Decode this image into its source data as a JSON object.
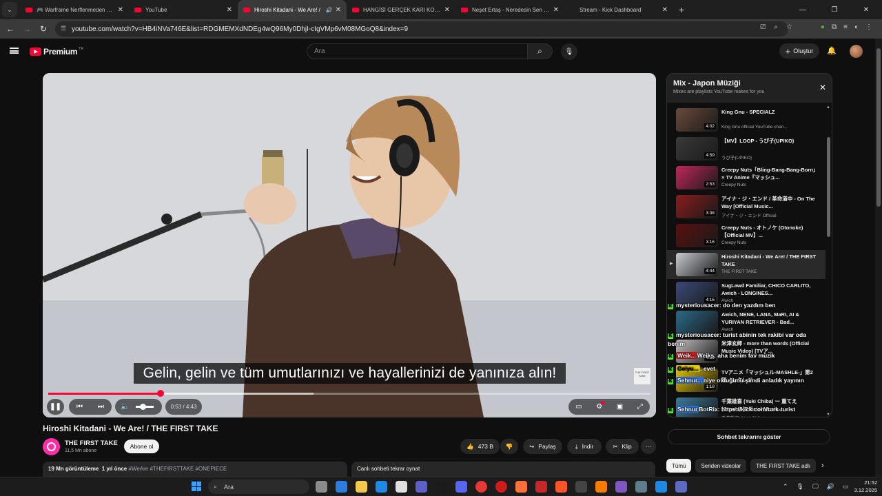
{
  "browser": {
    "tabs": [
      {
        "title": "🎮 Warframe Nerflenmeden Ö…",
        "favicon": "youtube-icon",
        "active": false,
        "audio": false
      },
      {
        "title": "YouTube",
        "favicon": "youtube-icon",
        "active": false,
        "audio": false
      },
      {
        "title": "Hiroshi Kitadani - We Are! /",
        "favicon": "youtube-icon",
        "active": true,
        "audio": true
      },
      {
        "title": "HANGİSİ GERÇEK KARI KOCA?!",
        "favicon": "youtube-icon",
        "active": false,
        "audio": false
      },
      {
        "title": "Neşet Ertaş - Neredesin Sen (Ja…",
        "favicon": "youtube-icon",
        "active": false,
        "audio": false
      },
      {
        "title": "Stream - Kick Dashboard",
        "favicon": "kick-icon",
        "active": false,
        "audio": false
      }
    ],
    "url": "youtube.com/watch?v=HB4iNVa746E&list=RDGMEMXdNDEg4wQ96My0DhjI-cIgVMp6vM08MGoQ8&index=9",
    "icons": [
      "back-icon",
      "forward-icon",
      "reload-icon",
      "site-info-icon",
      "cast-icon",
      "zoom-icon",
      "bookmark-star-icon",
      "extension-icon",
      "puzzle-icon",
      "reading-list-icon",
      "profile-icon",
      "menu-icon"
    ]
  },
  "youtube": {
    "logo_text": "Premium",
    "logo_mark": "TR",
    "search_placeholder": "Ara",
    "create_label": "Oluştur"
  },
  "player": {
    "subtitle": "Gelin, gelin ve tüm umutlarınızı ve hayallerinizi de yanınıza alın!",
    "watermark": "THE FIRST TAKE",
    "current_time": "0:53",
    "duration": "4:43",
    "progress": 0.187,
    "buffered": 0.44,
    "volume": 0.3,
    "state": "playing"
  },
  "video": {
    "title": "Hiroshi Kitadani - We Are! / THE FIRST TAKE",
    "channel": "THE FIRST TAKE",
    "subscribers": "11,5 Mn abone",
    "subscribe_label": "Abone ol",
    "likes": "473 B",
    "share_label": "Paylaş",
    "download_label": "İndir",
    "clip_label": "Klip",
    "views": "19 Mn görüntüleme",
    "age": "1 yıl önce",
    "tags": "#WeAre #THEFIRSTTAKE #ONEPIECE",
    "live_chat_replay": "Canlı sohbeti tekrar oynat"
  },
  "playlist": {
    "title": "Mix - Japon Müziği",
    "subtitle": "Mixes are playlists YouTube makes for you",
    "items": [
      {
        "title": "King Gnu - SPECIALZ",
        "channel": "King Gnu official YouTube chan...",
        "duration": "4:02",
        "current": false,
        "thumb_color": "#6b4a3a"
      },
      {
        "title": "【MV】LOOP - うぴ子(UPIKO)",
        "channel": "うぴ子(UPIKO)",
        "duration": "4:59",
        "current": false,
        "thumb_color": "#3a3a3a"
      },
      {
        "title": "Creepy Nuts「Bling-Bang-Bang-Born」× TV Anime『マッシュ...",
        "channel": "Creepy Nuts",
        "duration": "2:53",
        "current": false,
        "thumb_color": "#c0275a"
      },
      {
        "title": "アイナ・ジ・エンド / 革命道中 - On The Way [Official Music...",
        "channel": "アイナ・ジ・エンド Official",
        "duration": "3:38",
        "current": false,
        "thumb_color": "#8a1c1c"
      },
      {
        "title": "Creepy Nuts - オトノケ (Otonoke) 【Official MV】...",
        "channel": "Creepy Nuts",
        "duration": "3:16",
        "current": false,
        "thumb_color": "#5a1010"
      },
      {
        "title": "Hiroshi Kitadani - We Are! / THE FIRST TAKE",
        "channel": "THE FIRST TAKE",
        "duration": "4:44",
        "current": true,
        "thumb_color": "#c9ccd2"
      },
      {
        "title": "SugLawd Familiar, CHICO CARLITO, Awich - LONGINES...",
        "channel": "Awich",
        "duration": "4:16",
        "current": false,
        "thumb_color": "#3b4a7a"
      },
      {
        "title": "Awich, NENE, LANA, MaRI, AI & YURIYAN RETRIEVER - Bad...",
        "channel": "Awich",
        "duration": "",
        "current": false,
        "thumb_color": "#2a6a8a"
      },
      {
        "title": "米津玄師 - more than words (Official Music Video) [TVア...",
        "channel": "",
        "duration": "4:59",
        "current": false,
        "thumb_color": "#bfbfbf"
      },
      {
        "title": "TVアニメ「マッシュル-MASHLE-」第2期ノンクレジ...",
        "channel": "",
        "duration": "1:18",
        "current": false,
        "thumb_color": "#e0c000"
      },
      {
        "title": "千葉雄喜 (Yuki Chiba) ー 重てえ (Omote) [Official Music...",
        "channel": "千葉雄喜 (Yuki Chiba)",
        "duration": "",
        "current": false,
        "thumb_color": "#3a7a9a"
      }
    ],
    "show_chat_replay": "Sohbet tekrarını göster"
  },
  "kick_chat": [
    {
      "user": "mysteriousacer",
      "message": ": do den yazdım ben",
      "tag": ""
    },
    {
      "user": "mysteriousacer",
      "message": ": turist abinin tek rakibi var oda benim",
      "tag": ""
    },
    {
      "user": "Weiks",
      "message": ": aha benim fav müzik",
      "tag": "Weik..."
    },
    {
      "user": "",
      "message": ": evet",
      "tag": "Gelyu..."
    },
    {
      "user": "",
      "message": "niye olduğunu şimdi anladık yayının",
      "tag": "Sehnur..."
    },
    {
      "user": "BotRix",
      "message": ": https://kick.com/turk-turist",
      "tag": "Sehnur"
    }
  ],
  "chips": [
    "Tümü",
    "Seriden videolar",
    "THE FIRST TAKE adlı"
  ],
  "taskbar": {
    "search_placeholder": "Ara",
    "time": "21:52",
    "date": "3.12.2025",
    "app_colors": [
      "#8a8a8a",
      "#2d7de0",
      "#f2c94c",
      "#1e88e5",
      "#e0e0e0",
      "#5b5fc7",
      "#1b1b1b",
      "#5865f2",
      "#e53935",
      "#d11a1a",
      "#ff7139",
      "#c62828",
      "#fb542b",
      "#444444",
      "#f57c00",
      "#7e57c2",
      "#607d8b",
      "#1e88e5",
      "#5c6bc0"
    ]
  }
}
